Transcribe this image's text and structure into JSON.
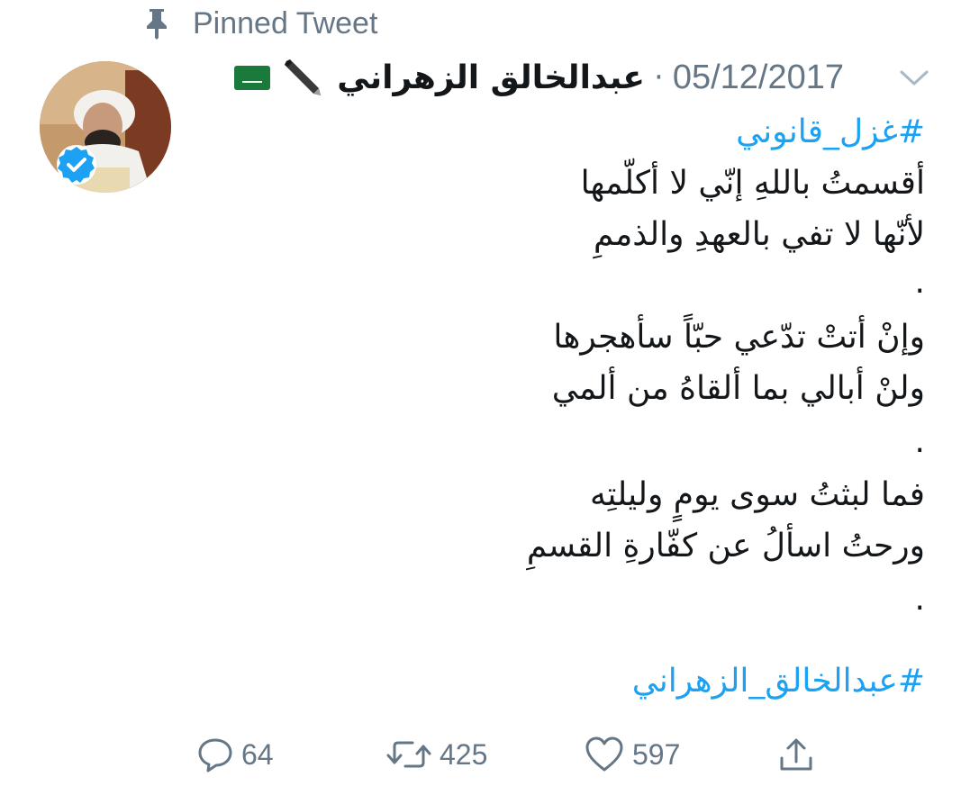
{
  "pinned": {
    "label": "Pinned Tweet",
    "icon": "pin-icon"
  },
  "author": {
    "name": "عبدالخالق الزهراني",
    "emoji_icons": [
      "pen-icon",
      "saudi-flag-icon"
    ],
    "verified": true,
    "avatar": "avatar"
  },
  "tweet": {
    "separator": "·",
    "date": "05/12/2017",
    "menu_icon": "chevron-down-icon",
    "hashtag_top": "#غزل_قانوني",
    "lines": [
      "أقسمتُ باللهِ إنّي لا أكلّمها",
      "لأنّها لا تفي بالعهدِ والذممِ",
      ".",
      "وإنْ أتتْ تدّعي حبّاً سأهجرها",
      "ولنْ أبالي بما ألقاهُ من ألمي",
      ".",
      "فما لبثتُ سوى يومٍ وليلتِه",
      "ورحتُ اسألُ عن كفّارةِ القسمِ",
      "."
    ],
    "hashtag_bottom": "#عبدالخالق_الزهراني"
  },
  "actions": {
    "reply_count": "64",
    "retweet_count": "425",
    "like_count": "597"
  },
  "colors": {
    "link": "#1da1f2",
    "muted": "#657786",
    "text": "#14171a",
    "verified": "#1da1f2"
  }
}
